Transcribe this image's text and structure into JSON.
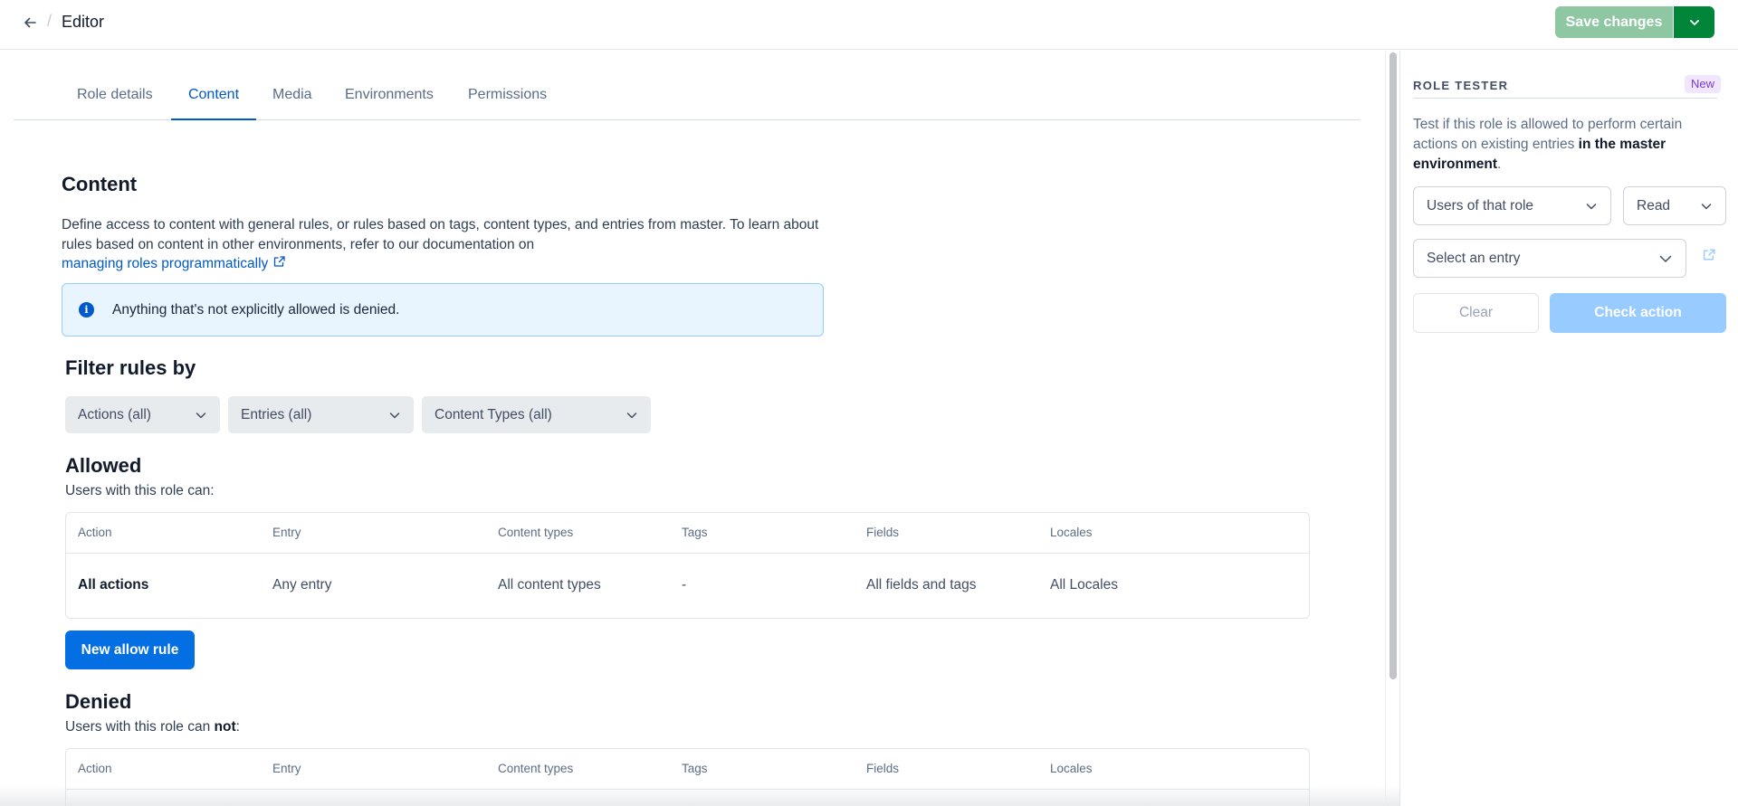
{
  "header": {
    "title": "Editor",
    "save_label": "Save changes"
  },
  "tabs": [
    {
      "label": "Role details"
    },
    {
      "label": "Content"
    },
    {
      "label": "Media"
    },
    {
      "label": "Environments"
    },
    {
      "label": "Permissions"
    }
  ],
  "active_tab": "Content",
  "content": {
    "heading": "Content",
    "description": "Define access to content with general rules, or rules based on tags, content types, and entries from master. To learn about rules based on content in other environments, refer to our documentation on",
    "doc_link": "managing roles programmatically",
    "note": "Anything that's not explicitly allowed is denied."
  },
  "filters": {
    "heading": "Filter rules by",
    "actions": "Actions (all)",
    "entries": "Entries (all)",
    "content_types": "Content Types (all)"
  },
  "columns": [
    "Action",
    "Entry",
    "Content types",
    "Tags",
    "Fields",
    "Locales"
  ],
  "allowed": {
    "heading": "Allowed",
    "subtitle": "Users with this role can:",
    "rows": [
      [
        "All actions",
        "Any entry",
        "All content types",
        "-",
        "All fields and tags",
        "All Locales"
      ]
    ],
    "button": "New allow rule"
  },
  "denied": {
    "heading": "Denied",
    "subtitle_pre": "Users with this role can ",
    "subtitle_bold": "not",
    "subtitle_post": ":"
  },
  "role_tester": {
    "title": "ROLE TESTER",
    "badge": "New",
    "desc_pre": "Test if this role is allowed to perform certain actions on existing entries ",
    "desc_bold": "in the master environment",
    "desc_post": ".",
    "who": "Users of that role",
    "action": "Read",
    "entry_placeholder": "Select an entry",
    "clear": "Clear",
    "check": "Check action"
  },
  "colors": {
    "accent": "#0059c8",
    "primary_button": "#036fe3",
    "save_disabled": "#8fc7a3",
    "save_caret": "#008539",
    "badge_bg": "#f1e6ff",
    "info_bg": "#e8f5ff"
  }
}
